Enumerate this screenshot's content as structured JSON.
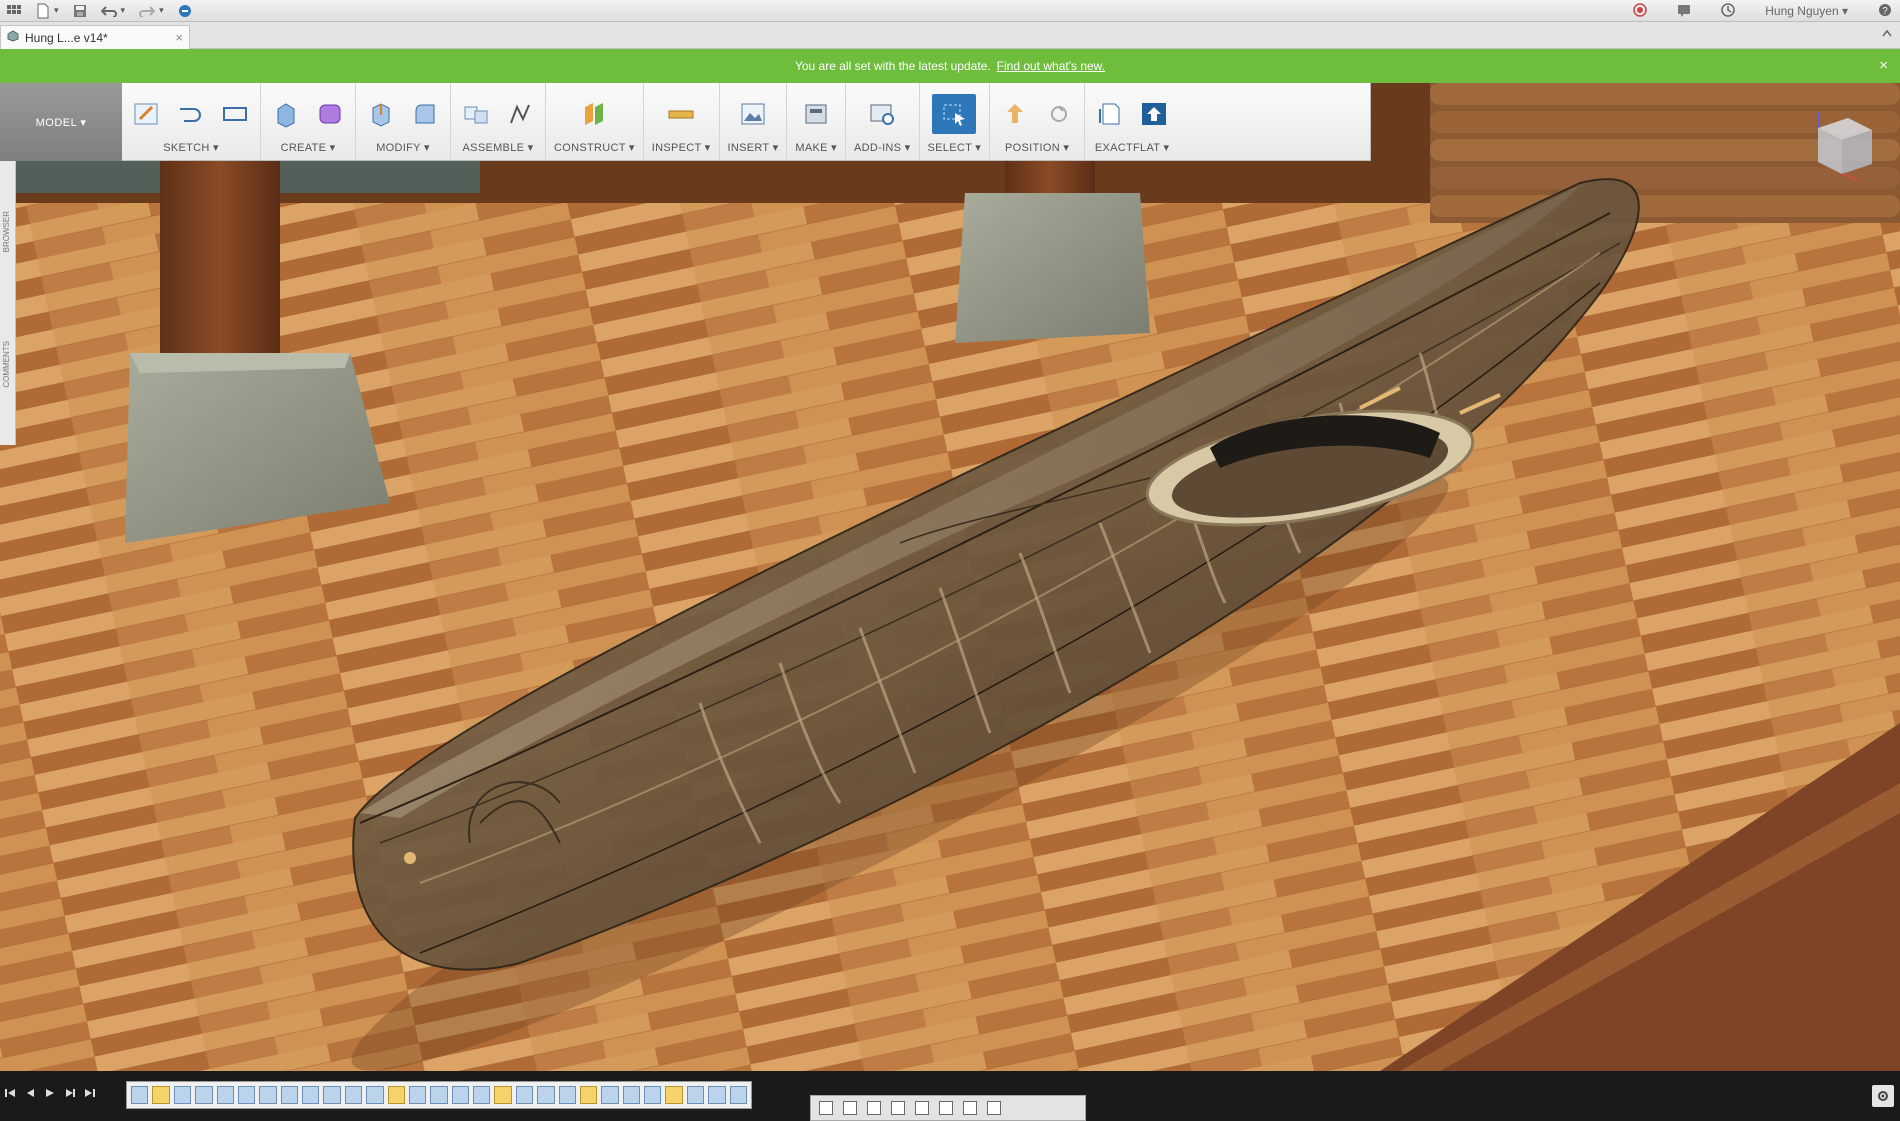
{
  "titlebar": {
    "user": "Hung Nguyen"
  },
  "tabs": [
    {
      "label": "Hung L...e v14*",
      "close": "×"
    }
  ],
  "banner": {
    "message": "You are all set with the latest update.",
    "link": "Find out what's new.",
    "close": "×"
  },
  "toolbar": {
    "workspace": "MODEL ▾",
    "groups": [
      {
        "label": "SKETCH ▾"
      },
      {
        "label": "CREATE ▾"
      },
      {
        "label": "MODIFY ▾"
      },
      {
        "label": "ASSEMBLE ▾"
      },
      {
        "label": "CONSTRUCT ▾"
      },
      {
        "label": "INSPECT ▾"
      },
      {
        "label": "INSERT ▾"
      },
      {
        "label": "MAKE ▾"
      },
      {
        "label": "ADD-INS ▾"
      },
      {
        "label": "SELECT ▾"
      },
      {
        "label": "POSITION ▾"
      },
      {
        "label": "EXACTFLAT ▾"
      }
    ]
  },
  "leftpanel": {
    "browser": "BROWSER",
    "comments": "COMMENTS"
  },
  "colors": {
    "banner": "#6ebd3c",
    "select_active": "#2d77b8",
    "floor": "#c98a4e"
  }
}
